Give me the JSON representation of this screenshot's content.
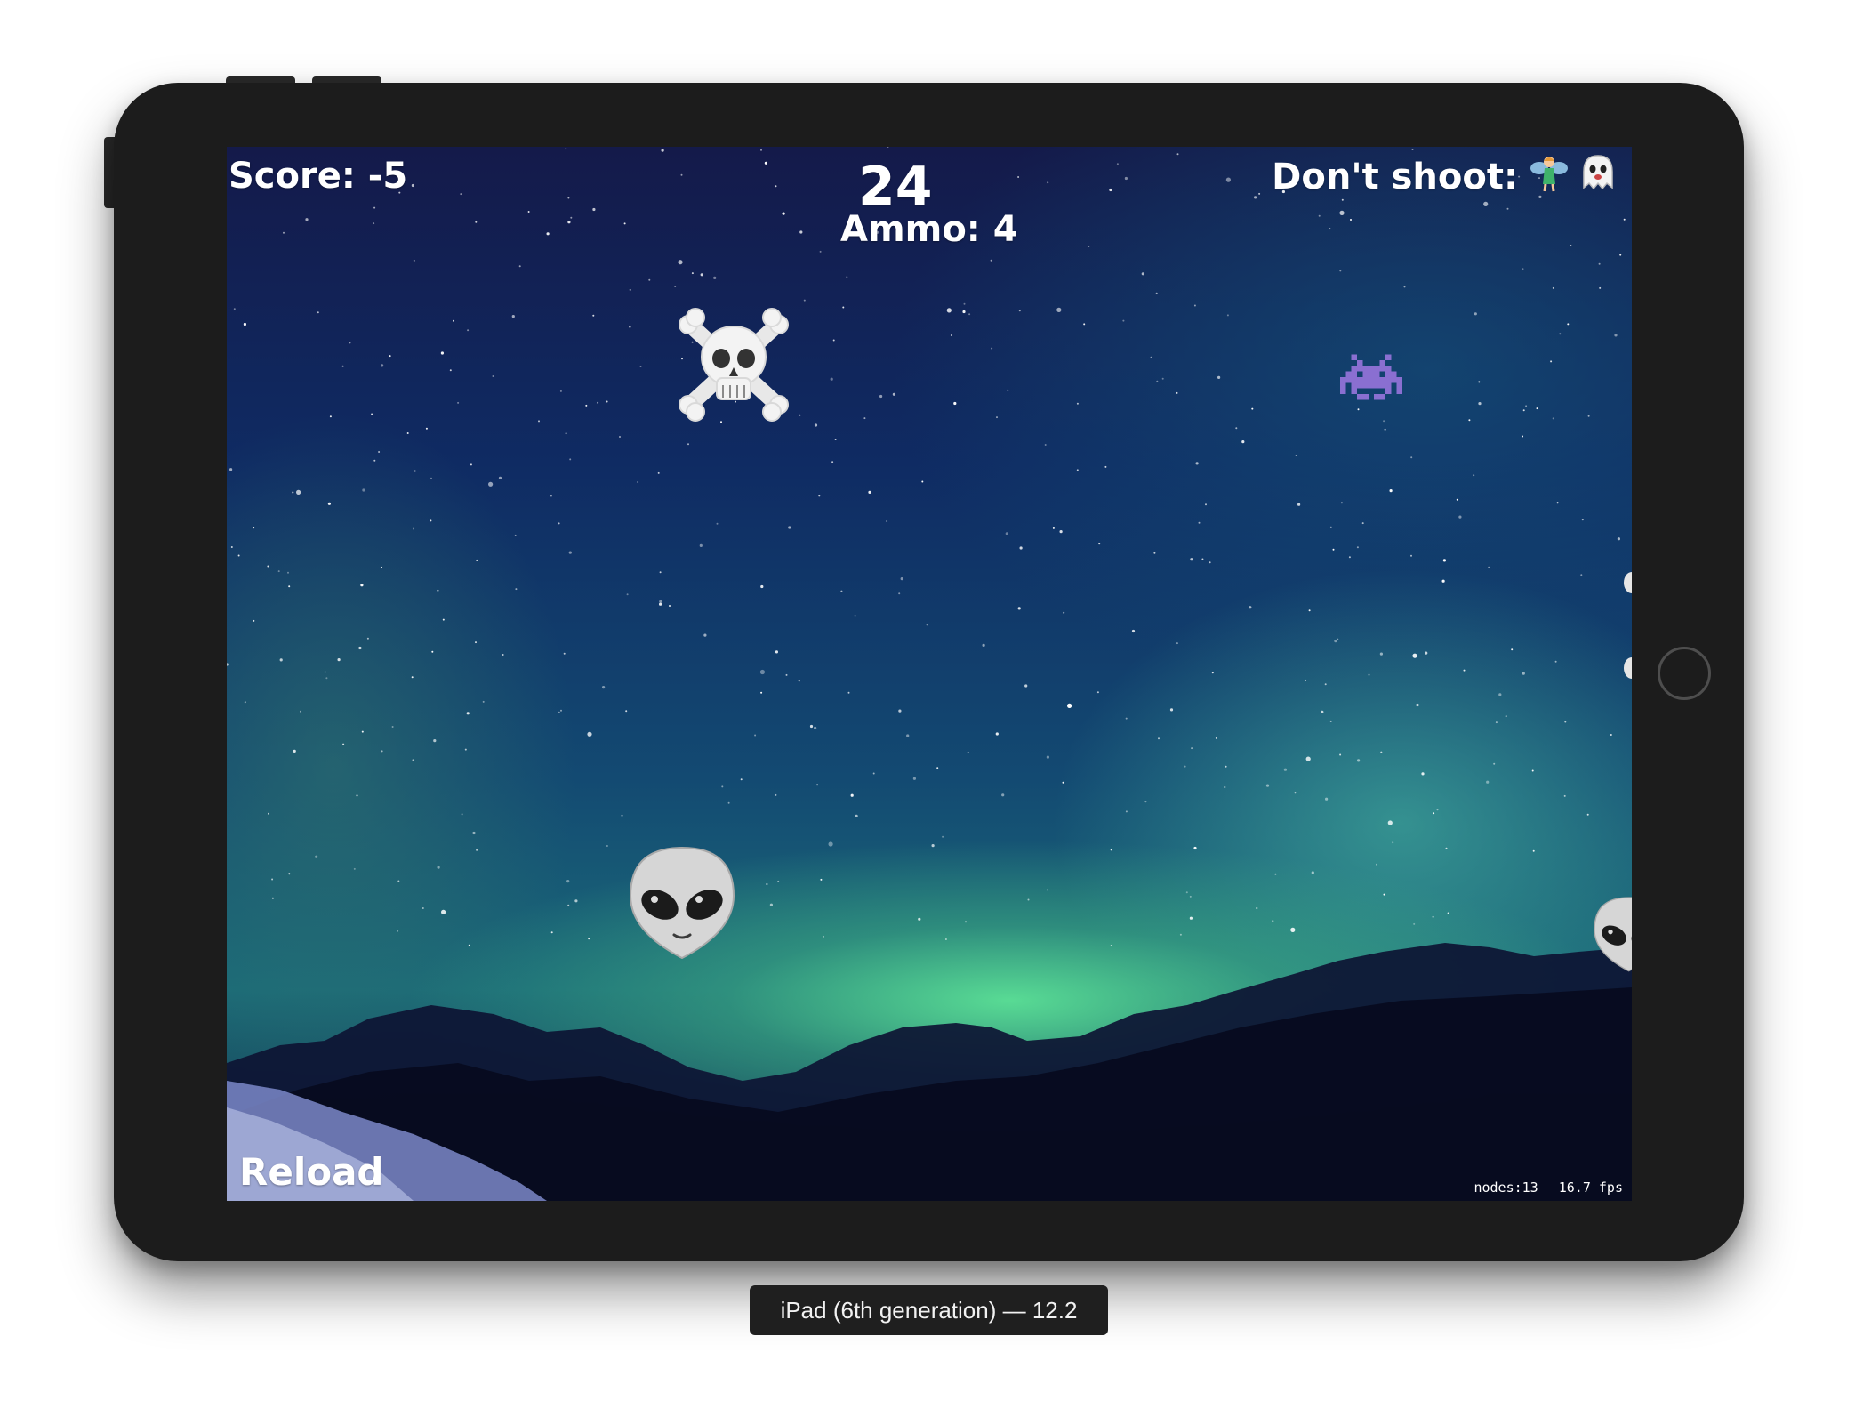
{
  "device": {
    "caption": "iPad (6th generation) — 12.2"
  },
  "hud": {
    "score": "Score: -5",
    "timer": "24",
    "ammo": "Ammo: 4",
    "dont_shoot_label": "Don't shoot:",
    "dont_shoot_icons": [
      "fairy-icon",
      "ghost-icon"
    ],
    "reload": "Reload",
    "debug_nodes": "nodes:13",
    "debug_fps": "16.7 fps"
  },
  "targets": [
    {
      "icon": "skull-and-crossbones-icon"
    },
    {
      "icon": "space-invader-icon"
    },
    {
      "icon": "alien-icon"
    },
    {
      "icon": "alien-icon"
    }
  ],
  "colors": {
    "hud_text": "#ffffff",
    "device_body": "#1c1c1c",
    "caption_bg": "#1f1f1f",
    "aurora_green": "#5ce196",
    "night_sky": "#0f2b63"
  }
}
